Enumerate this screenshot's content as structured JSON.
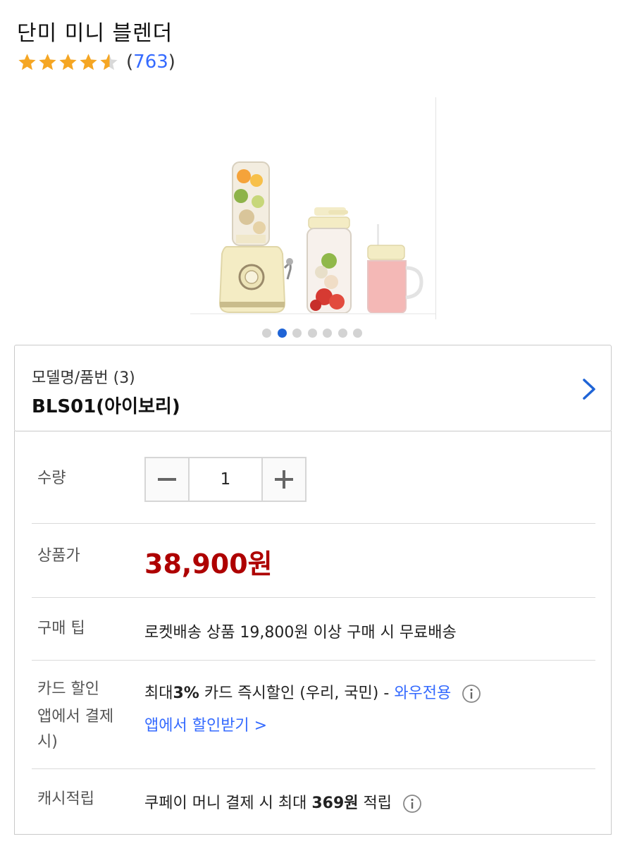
{
  "product": {
    "title": "단미 미니 블렌더",
    "rating_stars": 4.5,
    "review_count": "763",
    "paren_open": "(",
    "paren_close": ")"
  },
  "gallery": {
    "dot_count": 7,
    "active_index": 1
  },
  "option": {
    "label": "모델명/품번 (3)",
    "value": "BLS01(아이보리)"
  },
  "quantity": {
    "label": "수량",
    "value": "1"
  },
  "price": {
    "label": "상품가",
    "value": "38,900원"
  },
  "tip": {
    "label": "구매 팁",
    "text": "로켓배송 상품 19,800원 이상 구매 시 무료배송"
  },
  "card": {
    "label_line1": "카드 할인",
    "label_line2": "앱에서 결제",
    "label_line3": "시)",
    "prefix": "최대",
    "percent": "3%",
    "text": " 카드 즉시할인 (우리, 국민) - ",
    "wow": "와우전용",
    "app_link": "앱에서 할인받기 >"
  },
  "cash": {
    "label": "캐시적립",
    "prefix": "쿠페이 머니 결제 시 최대 ",
    "amount": "369원",
    "suffix": " 적립"
  },
  "colors": {
    "price_red": "#ae0000",
    "link_blue": "#346aff",
    "star_orange": "#f5a623",
    "dot_active": "#1f64d6"
  }
}
